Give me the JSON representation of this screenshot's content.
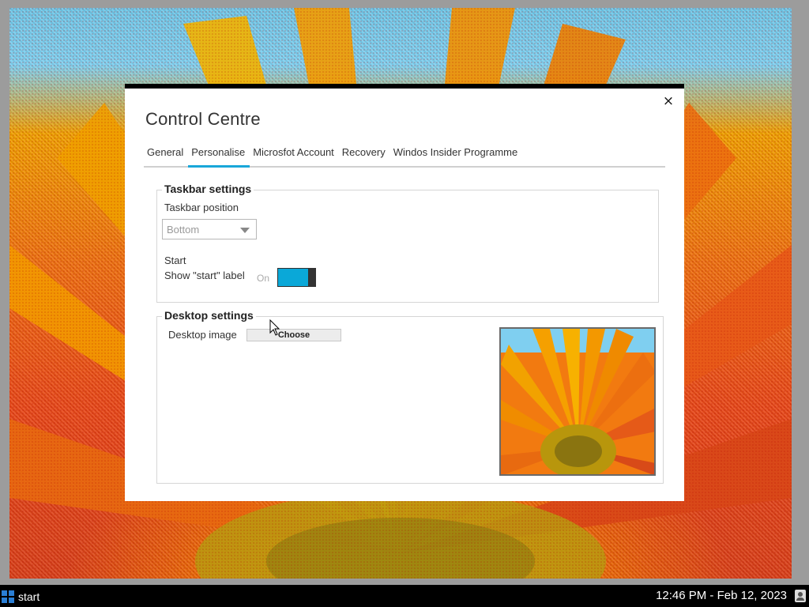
{
  "window": {
    "title": "Control Centre",
    "close_glyph": "×",
    "tabs": [
      {
        "label": "General",
        "active": false
      },
      {
        "label": "Personalise",
        "active": true
      },
      {
        "label": "Microsfot Account",
        "active": false
      },
      {
        "label": "Recovery",
        "active": false
      },
      {
        "label": "Windos Insider Programme",
        "active": false
      }
    ]
  },
  "taskbar_settings": {
    "title": "Taskbar settings",
    "position_label": "Taskbar position",
    "position_value": "Bottom",
    "position_options": [
      "Bottom"
    ],
    "start_heading": "Start",
    "show_start_label": "Show \"start\" label",
    "toggle_state": "On",
    "toggle_on": true
  },
  "desktop_settings": {
    "title": "Desktop settings",
    "image_label": "Desktop image",
    "choose_label": "Choose"
  },
  "taskbar": {
    "start_label": "start",
    "clock": "12:46 PM - Feb 12, 2023"
  },
  "colors": {
    "accent": "#19a7d9",
    "toggle_on": "#0aa8d8",
    "window_bg": "#ffffff",
    "taskbar_bg": "#000000"
  },
  "icons": {
    "close": "close-icon",
    "dropdown": "chevron-down-icon",
    "start": "windows-logo-icon",
    "tray": "user-icon",
    "cursor": "mouse-cursor-icon"
  }
}
